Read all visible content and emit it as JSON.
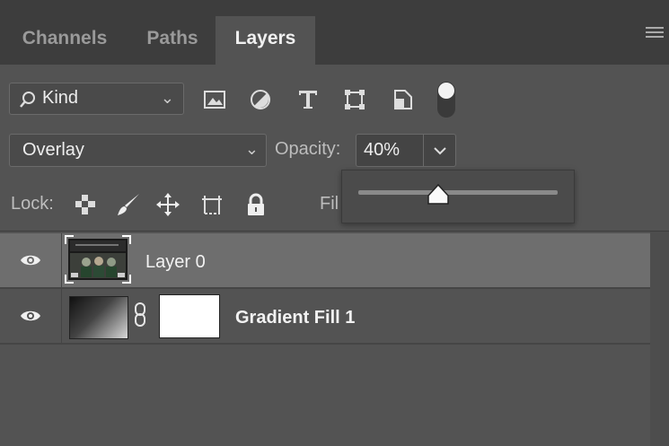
{
  "tabs": [
    {
      "label": "Channels",
      "active": false
    },
    {
      "label": "Paths",
      "active": false
    },
    {
      "label": "Layers",
      "active": true
    }
  ],
  "filter": {
    "kind_label": "Kind",
    "icons": [
      "image-filter-icon",
      "adjustment-filter-icon",
      "type-filter-icon",
      "shape-filter-icon",
      "smart-object-filter-icon",
      "filter-toggle-icon"
    ]
  },
  "blend": {
    "mode": "Overlay",
    "opacity_label": "Opacity:",
    "opacity_value": "40%",
    "opacity_fraction": 0.4
  },
  "lock": {
    "label": "Lock:",
    "fill_label": "Fil",
    "icons": [
      "lock-transparent-pixels-icon",
      "lock-image-pixels-icon",
      "lock-position-icon",
      "prevent-autonest-icon",
      "lock-all-icon"
    ]
  },
  "layers": [
    {
      "name": "Layer 0",
      "selected": true,
      "visible": true
    },
    {
      "name": "Gradient Fill 1",
      "selected": false,
      "visible": true
    }
  ],
  "colors": {
    "panel": "#535353",
    "selected_row": "#6e6e6e",
    "tabbar": "#3d3d3d"
  }
}
